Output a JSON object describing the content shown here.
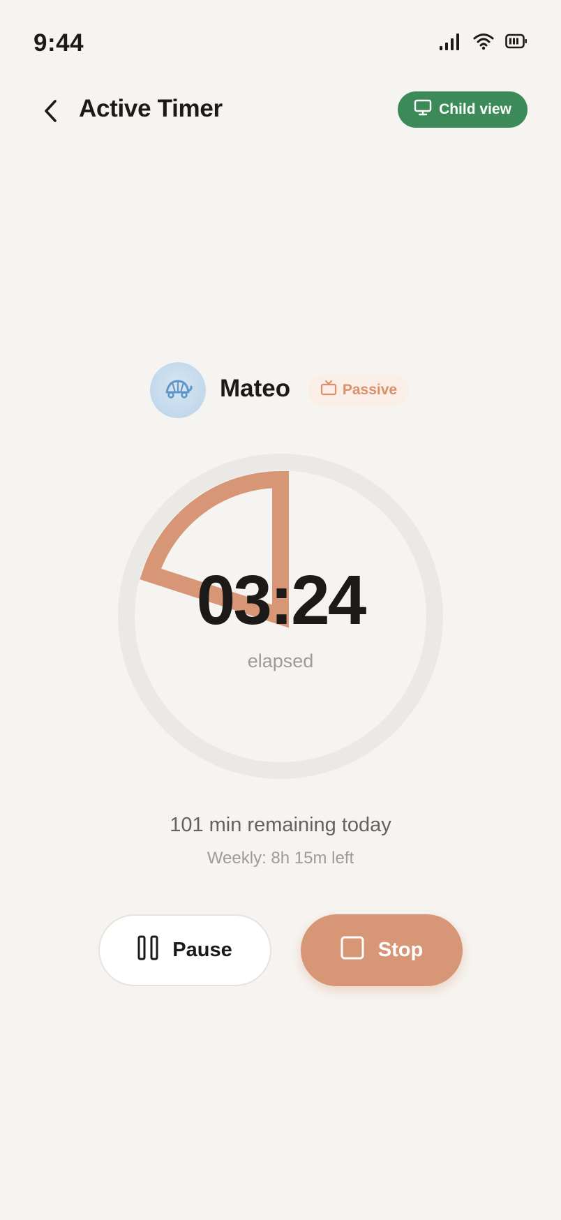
{
  "status_bar": {
    "time": "9:44",
    "icons": [
      "signal-icon",
      "wifi-icon",
      "battery-icon"
    ]
  },
  "header": {
    "title": "Active Timer",
    "child_view_label": "Child view"
  },
  "profile": {
    "name": "Mateo",
    "avatar_icon": "turtle-icon",
    "activity_label": "Passive",
    "activity_icon": "tv-icon"
  },
  "timer": {
    "time": "03:24",
    "label": "elapsed",
    "progress_fraction": 0.2
  },
  "summary": {
    "remaining_today": "101 min remaining today",
    "weekly_left": "Weekly: 8h 15m left"
  },
  "controls": {
    "pause_label": "Pause",
    "stop_label": "Stop"
  },
  "colors": {
    "accent": "#d79676",
    "child_view_green": "#3b8a57",
    "ring_track": "#ebe9e6",
    "background": "#f6f4f1"
  }
}
